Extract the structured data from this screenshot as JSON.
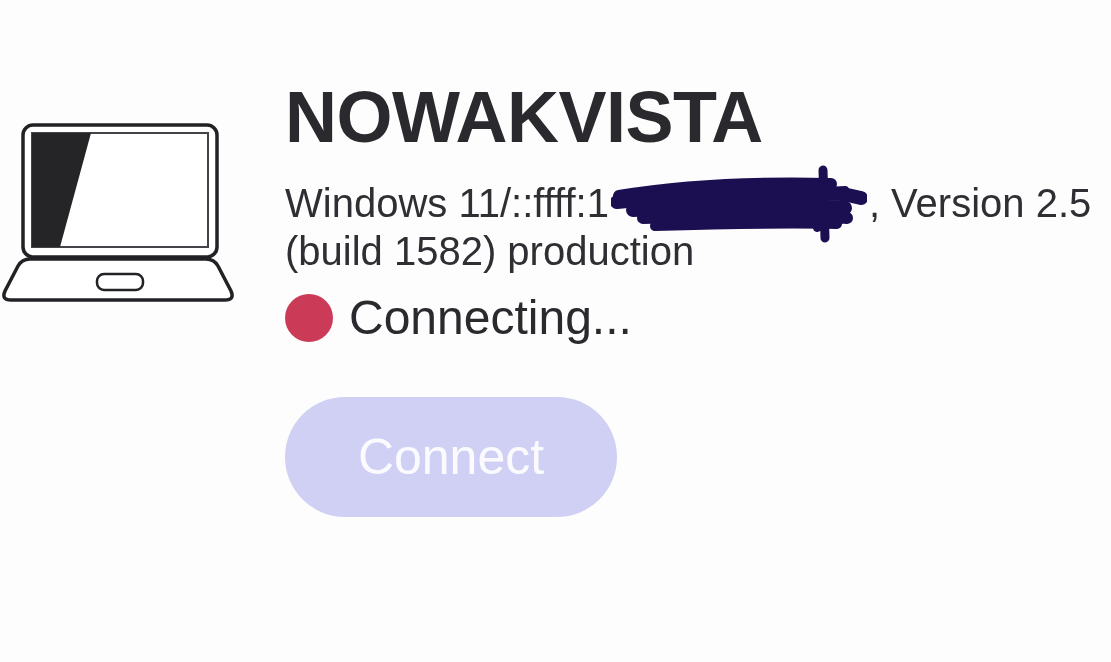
{
  "device": {
    "name": "NOWAKVISTA",
    "details": {
      "prefix": "Windows 11/::ffff:1",
      "redacted": true,
      "suffix": ", Version 2.5",
      "continuation": "(build 1582) production"
    }
  },
  "status": {
    "label": "Connecting...",
    "connected": false
  },
  "connect_button": {
    "label": "Connect",
    "disabled": true
  }
}
